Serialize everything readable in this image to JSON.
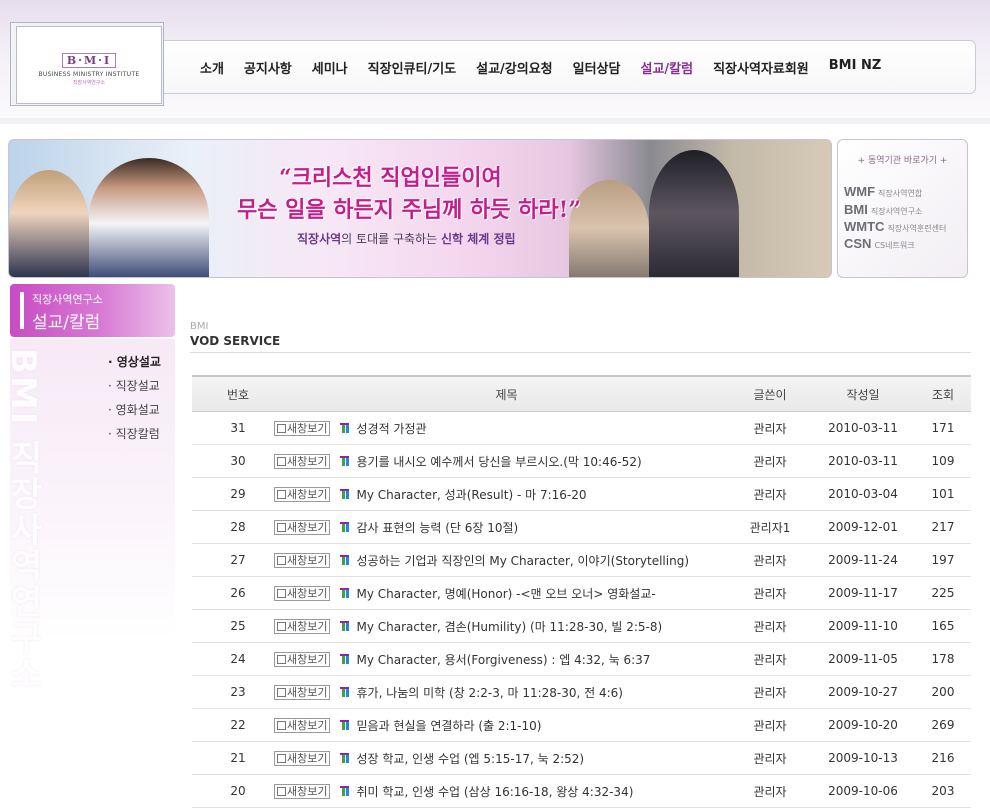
{
  "logo": {
    "mark": "B·M·I",
    "sub": "BUSINESS MINISTRY INSTITUTE",
    "sub2": "직장사역연구소"
  },
  "nav": {
    "items": [
      {
        "label": "소개"
      },
      {
        "label": "공지사항"
      },
      {
        "label": "세미나"
      },
      {
        "label": "직장인큐티/기도"
      },
      {
        "label": "설교/강의요청"
      },
      {
        "label": "일터상담"
      },
      {
        "label": "설교/칼럼",
        "active": true
      },
      {
        "label": "직장사역자료회원"
      },
      {
        "label": "BMI NZ"
      }
    ]
  },
  "banner": {
    "line1": "“크리스천 직업인들이여",
    "line2": "무슨 일을 하든지 주님께 하듯 하라!”",
    "line3_bold": "직장사역",
    "line3_mid": "의 토대를 구축하는 ",
    "line3_bold2": "신학 체계 정립"
  },
  "related": {
    "title": "+ 동역기관 바로가기 +",
    "items": [
      {
        "abbr": "WMF",
        "full": "직장사역연합"
      },
      {
        "abbr": "BMI",
        "full": "직장사역연구소"
      },
      {
        "abbr": "WMTC",
        "full": "직장사역훈련센터"
      },
      {
        "abbr": "CSN",
        "full": "CS네트워크"
      }
    ]
  },
  "sidebar": {
    "org": "직장사역연구소",
    "section": "설교/칼럼",
    "ghost": "BMI 직장사역연구소",
    "items": [
      {
        "label": "· 영상설교",
        "active": true
      },
      {
        "label": "· 직장설교"
      },
      {
        "label": "· 영화설교"
      },
      {
        "label": "· 직장칼럼"
      }
    ]
  },
  "board": {
    "crumb_top": "BMI",
    "crumb_main": "VOD SERVICE",
    "popup_label": "새창보기",
    "columns": {
      "no": "번호",
      "title": "제목",
      "writer": "글쓴이",
      "date": "작성일",
      "views": "조회"
    },
    "rows": [
      {
        "no": "31",
        "title": "성경적 가정관",
        "writer": "관리자",
        "date": "2010-03-11",
        "views": "171"
      },
      {
        "no": "30",
        "title": "용기를 내시오 예수께서 당신을 부르시오.(막 10:46-52)",
        "writer": "관리자",
        "date": "2010-03-11",
        "views": "109"
      },
      {
        "no": "29",
        "title": "My Character, 성과(Result) - 마 7:16-20",
        "writer": "관리자",
        "date": "2010-03-04",
        "views": "101"
      },
      {
        "no": "28",
        "title": "감사 표현의 능력 (단 6장 10절)",
        "writer": "관리자1",
        "date": "2009-12-01",
        "views": "217"
      },
      {
        "no": "27",
        "title": "성공하는 기업과 직장인의 My Character, 이야기(Storytelling)",
        "writer": "관리자",
        "date": "2009-11-24",
        "views": "197"
      },
      {
        "no": "26",
        "title": "My Character, 명예(Honor) -<맨 오브 오너> 영화설교-",
        "writer": "관리자",
        "date": "2009-11-17",
        "views": "225"
      },
      {
        "no": "25",
        "title": "My Character, 겸손(Humility) (마 11:28-30, 빌 2:5-8)",
        "writer": "관리자",
        "date": "2009-11-10",
        "views": "165"
      },
      {
        "no": "24",
        "title": "My Character, 용서(Forgiveness) : 엡 4:32, 눅 6:37",
        "writer": "관리자",
        "date": "2009-11-05",
        "views": "178"
      },
      {
        "no": "23",
        "title": "휴가, 나눔의 미학 (창 2:2-3, 마 11:28-30, 전 4:6)",
        "writer": "관리자",
        "date": "2009-10-27",
        "views": "200"
      },
      {
        "no": "22",
        "title": "믿음과 현실을 연결하라 (출 2:1-10)",
        "writer": "관리자",
        "date": "2009-10-20",
        "views": "269"
      },
      {
        "no": "21",
        "title": "성장 학교, 인생 수업 (엡 5:15-17, 눅 2:52)",
        "writer": "관리자",
        "date": "2009-10-13",
        "views": "216"
      },
      {
        "no": "20",
        "title": "취미 학교, 인생 수업 (삼상 16:16-18, 왕상 4:32-34)",
        "writer": "관리자",
        "date": "2009-10-06",
        "views": "203"
      }
    ]
  }
}
